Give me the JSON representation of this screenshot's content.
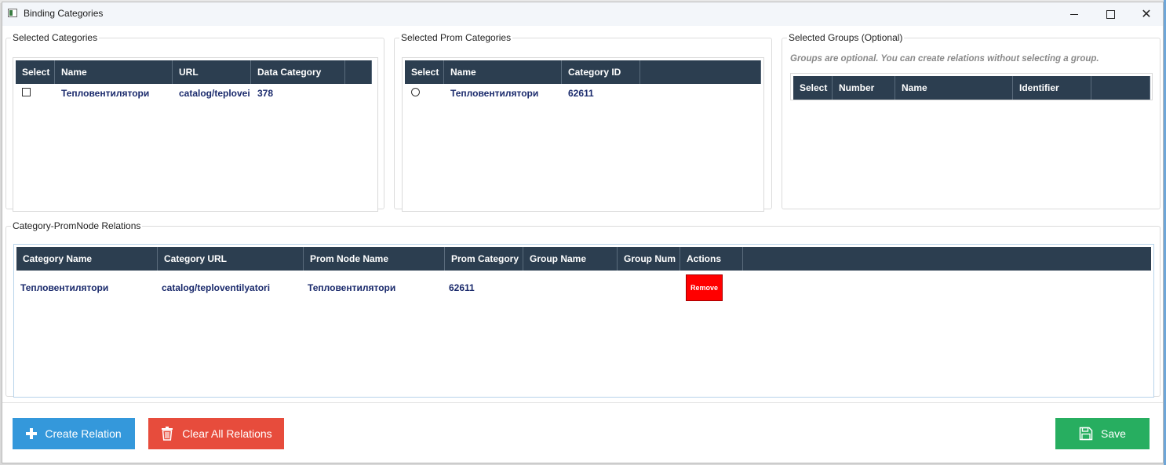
{
  "window": {
    "title": "Binding Categories",
    "close_glyph": "✕"
  },
  "selected_categories": {
    "legend": "Selected Categories",
    "columns": [
      "Select",
      "Name",
      "URL",
      "Data Category"
    ],
    "rows": [
      {
        "name": "Тепловентилятори",
        "url": "catalog/teplovei",
        "data_category": "378"
      }
    ]
  },
  "selected_prom": {
    "legend": "Selected Prom Categories",
    "columns": [
      "Select",
      "Name",
      "Category ID"
    ],
    "rows": [
      {
        "name": "Тепловентилятори",
        "category_id": "62611"
      }
    ]
  },
  "selected_groups": {
    "legend": "Selected Groups (Optional)",
    "hint": "Groups are optional. You can create relations without selecting a group.",
    "columns": [
      "Select",
      "Number",
      "Name",
      "Identifier"
    ]
  },
  "relations": {
    "legend": "Category-PromNode Relations",
    "columns": [
      "Category Name",
      "Category URL",
      "Prom Node Name",
      "Prom Category",
      "Group Name",
      "Group Num",
      "Actions"
    ],
    "rows": [
      {
        "category_name": "Тепловентилятори",
        "category_url": "catalog/teploventilyatori",
        "prom_node_name": "Тепловентилятори",
        "prom_category": "62611",
        "group_name": "",
        "group_num": "",
        "remove_label": "Remove"
      }
    ]
  },
  "buttons": {
    "create": "Create Relation",
    "clear": "Clear All Relations",
    "save": "Save"
  },
  "colors": {
    "header": "#2c3e50",
    "create": "#3498db",
    "clear": "#e74c3c",
    "save": "#27ae60",
    "remove": "#ff0000"
  },
  "icons": {
    "create": "plus-icon",
    "clear": "trash-icon",
    "save": "floppy-disk-icon",
    "app": "window-icon"
  }
}
